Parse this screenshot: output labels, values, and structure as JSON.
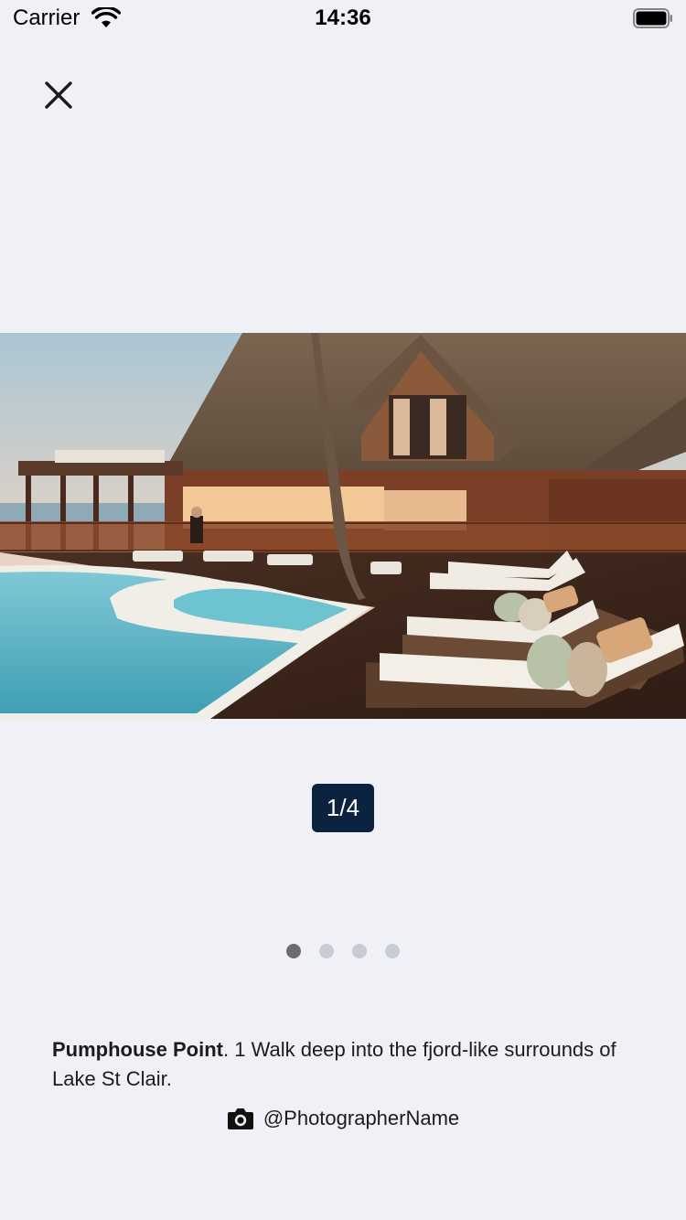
{
  "status_bar": {
    "carrier": "Carrier",
    "time": "14:36"
  },
  "gallery": {
    "photo_alt": "Resort pool deck with wooden lodge and sun loungers",
    "counter": "1/4",
    "total_dots": 4,
    "active_dot": 1
  },
  "caption": {
    "place_name": "Pumphouse Point",
    "description": ". 1 Walk deep into the fjord-like surrounds of Lake St Clair."
  },
  "credit": {
    "photographer": "@PhotographerName"
  },
  "icons": {
    "close": "close-icon",
    "camera": "camera-icon",
    "wifi": "wifi-icon",
    "battery": "battery-icon"
  },
  "colors": {
    "background": "#eff1f6",
    "counter_bg": "#0c2340",
    "dot_active": "#6b6d72",
    "dot_inactive": "#c9ccd4"
  }
}
